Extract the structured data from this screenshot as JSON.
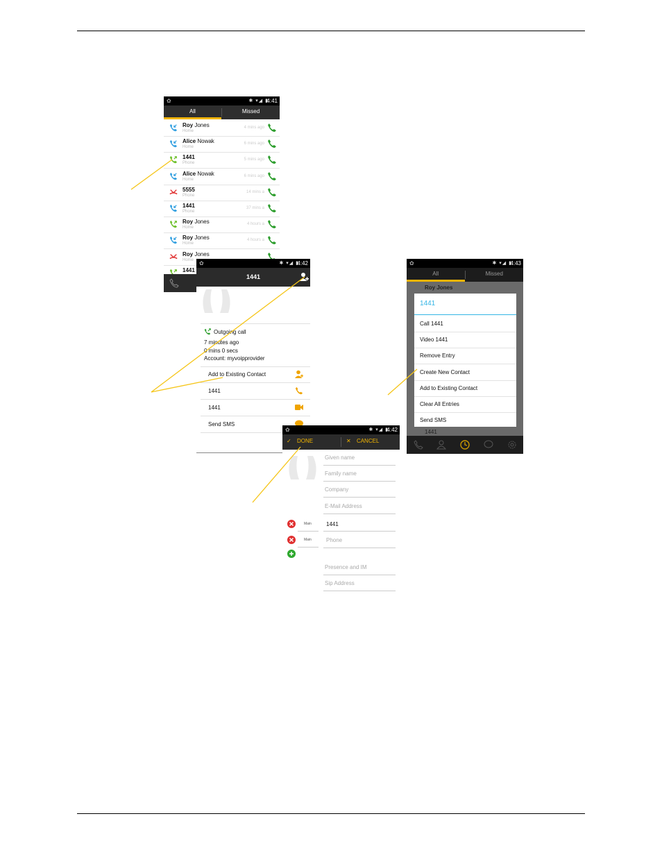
{
  "phone1": {
    "time": "4:41",
    "tabs": [
      "All",
      "Missed"
    ],
    "calls": [
      {
        "name": "Roy",
        "rest": " Jones",
        "type": "Home",
        "time": "4 mins ago",
        "dir": "in"
      },
      {
        "name": "Alice",
        "rest": " Nowak",
        "type": "Home",
        "time": "6 mins ago",
        "dir": "in"
      },
      {
        "name": "1441",
        "rest": "",
        "type": "Phone",
        "time": "5 mins ago",
        "dir": "out"
      },
      {
        "name": "Alice",
        "rest": " Nowak",
        "type": "Home",
        "time": "6 mins ago",
        "dir": "in"
      },
      {
        "name": "5555",
        "rest": "",
        "type": "Phone",
        "time": "14 mins a",
        "dir": "missed"
      },
      {
        "name": "1441",
        "rest": "",
        "type": "Phone",
        "time": "37 mins a",
        "dir": "in"
      },
      {
        "name": "Roy",
        "rest": " Jones",
        "type": "Home",
        "time": "4 hours a",
        "dir": "out"
      },
      {
        "name": "Roy",
        "rest": " Jones",
        "type": "Home",
        "time": "4 hours a",
        "dir": "in"
      },
      {
        "name": "Roy",
        "rest": " Jones",
        "type": "Home",
        "time": "",
        "dir": "missed"
      },
      {
        "name": "1441",
        "rest": "",
        "type": "",
        "time": "",
        "dir": "out"
      }
    ]
  },
  "phone2": {
    "time": "4:42",
    "title": "1441",
    "call_type": "Outgoing call",
    "ago": "7 minutes ago",
    "duration": "0 mins 0 secs",
    "account": "Account: myvoipprovider",
    "actions": [
      "Add to Existing Contact",
      "1441",
      "1441",
      "Send SMS"
    ]
  },
  "phone3": {
    "time": "4:43",
    "tabs": [
      "All",
      "Missed"
    ],
    "behind_row": "Roy Jones",
    "behind_last": "1441",
    "dialog_title": "1441",
    "items": [
      "Call 1441",
      "Video 1441",
      "Remove Entry",
      "Create New Contact",
      "Add to Existing Contact",
      "Clear All Entries",
      "Send SMS"
    ]
  },
  "phone4": {
    "time": "4:42",
    "done": "DONE",
    "cancel": "CANCEL",
    "fields": [
      "Given name",
      "Family name",
      "Company",
      "E-Mail Address"
    ],
    "phones": [
      {
        "label": "Main",
        "value": "1441"
      },
      {
        "label": "Main",
        "value": "Phone"
      }
    ],
    "extra": [
      "Presence and IM",
      "Sip Address"
    ]
  },
  "colors": {
    "accent": "#f0b400",
    "call_green": "#2e9e2e",
    "incoming_blue": "#33a0e0",
    "missed_red": "#e03030",
    "dialog_blue": "#33b5e5"
  }
}
